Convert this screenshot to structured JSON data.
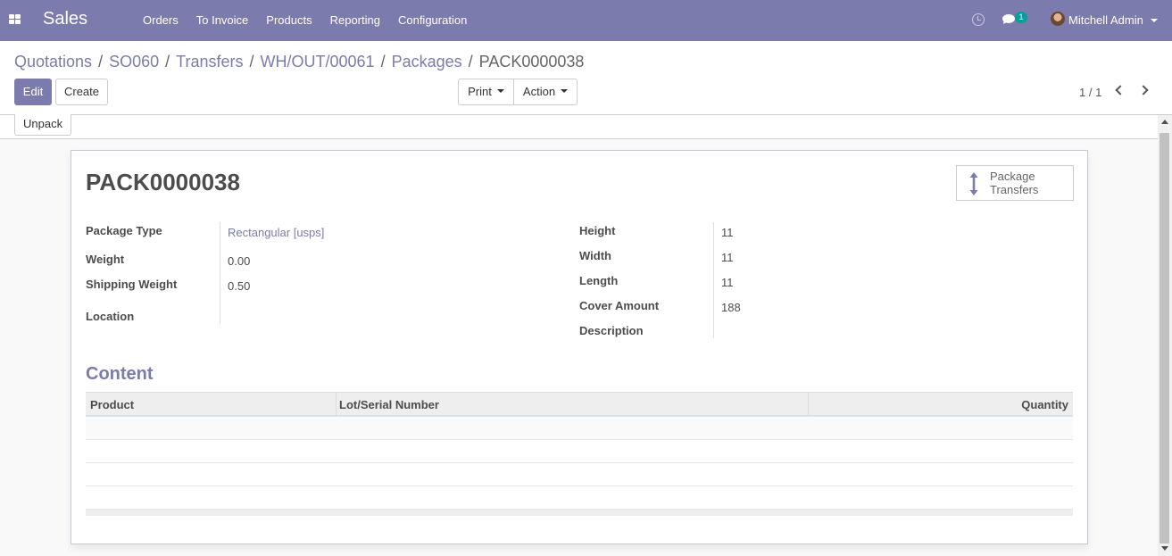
{
  "navbar": {
    "brand": "Sales",
    "menu": [
      "Orders",
      "To Invoice",
      "Products",
      "Reporting",
      "Configuration"
    ],
    "chat_badge": "1",
    "user_name": "Mitchell Admin"
  },
  "breadcrumb": {
    "items": [
      "Quotations",
      "SO060",
      "Transfers",
      "WH/OUT/00061",
      "Packages"
    ],
    "current": "PACK0000038"
  },
  "toolbar": {
    "edit": "Edit",
    "create": "Create",
    "print": "Print",
    "action": "Action",
    "pager": "1 / 1"
  },
  "statusbar": {
    "unpack": "Unpack"
  },
  "record": {
    "name": "PACK0000038",
    "smart_button": {
      "line1": "Package",
      "line2": "Transfers"
    },
    "left_fields": {
      "package_type": {
        "label": "Package Type",
        "value": "Rectangular [usps]"
      },
      "weight": {
        "label": "Weight",
        "value": "0.00"
      },
      "shipping_weight": {
        "label": "Shipping Weight",
        "value": "0.50"
      },
      "location": {
        "label": "Location",
        "value": ""
      }
    },
    "right_fields": {
      "height": {
        "label": "Height",
        "value": "11"
      },
      "width": {
        "label": "Width",
        "value": "11"
      },
      "length": {
        "label": "Length",
        "value": "11"
      },
      "cover_amount": {
        "label": "Cover Amount",
        "value": "188"
      },
      "description": {
        "label": "Description",
        "value": ""
      }
    },
    "content": {
      "title": "Content",
      "columns": [
        "Product",
        "Lot/Serial Number",
        "Quantity"
      ]
    }
  },
  "colors": {
    "brand": "#7c7bad",
    "badge": "#00a09d"
  }
}
